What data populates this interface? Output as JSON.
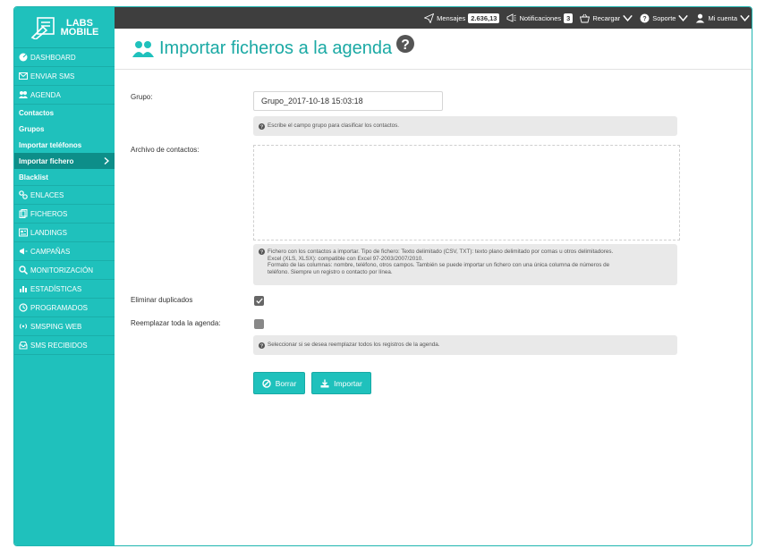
{
  "brand": {
    "line1": "LABS",
    "line2": "MOBILE"
  },
  "sidebar": {
    "items": [
      {
        "id": "dashboard",
        "label": "DASHBOARD"
      },
      {
        "id": "enviar-sms",
        "label": "ENVIAR SMS"
      },
      {
        "id": "agenda",
        "label": "AGENDA"
      }
    ],
    "agenda_sub": [
      {
        "id": "contactos",
        "label": "Contactos"
      },
      {
        "id": "grupos",
        "label": "Grupos"
      },
      {
        "id": "importar-telefonos",
        "label": "Importar teléfonos"
      },
      {
        "id": "importar-fichero",
        "label": "Importar fichero",
        "active": true
      },
      {
        "id": "blacklist",
        "label": "Blacklist"
      }
    ],
    "items2": [
      {
        "id": "enlaces",
        "label": "ENLACES"
      },
      {
        "id": "ficheros",
        "label": "FICHEROS"
      },
      {
        "id": "landings",
        "label": "LANDINGS"
      },
      {
        "id": "campanas",
        "label": "CAMPAÑAS"
      },
      {
        "id": "monitorizacion",
        "label": "MONITORIZACIÓN"
      },
      {
        "id": "estadisticas",
        "label": "ESTADÍSTICAS"
      },
      {
        "id": "programados",
        "label": "PROGRAMADOS"
      },
      {
        "id": "smsping-web",
        "label": "SMSPING WEB"
      },
      {
        "id": "sms-recibidos",
        "label": "SMS RECIBIDOS"
      }
    ]
  },
  "topbar": {
    "mensajes_label": "Mensajes",
    "mensajes_count": "2.636,13",
    "notificaciones_label": "Notificaciones",
    "notificaciones_count": "3",
    "recargar_label": "Recargar",
    "soporte_label": "Soporte",
    "cuenta_label": "Mi cuenta"
  },
  "page": {
    "title": "Importar ficheros a la agenda",
    "grupo_label": "Grupo:",
    "grupo_value": "Grupo_2017-10-18 15:03:18",
    "grupo_help": "Escribe el campo grupo para clasificar los contactos.",
    "archivo_label": "Archivo de contactos:",
    "archivo_help_1": "Fichero con los contactos a importar. Tipo de fichero: Texto delimitado (CSV, TXT): texto plano delimitado por comas u otros delimitadores.",
    "archivo_help_2": "Excel (XLS, XLSX): compatible con Excel 97-2003/2007/2010.",
    "archivo_help_3": "Formato de las columnas: nombre, teléfono, otros campos. También se puede importar un fichero con una única columna de números de",
    "archivo_help_4": "teléfono. Siempre un registro o contacto por línea.",
    "eliminar_label": "Eliminar duplicados",
    "reemplazar_label": "Reemplazar toda la agenda:",
    "reemplazar_help": "Seleccionar si se desea reemplazar todos los registros de la agenda.",
    "borrar_label": "Borrar",
    "importar_label": "Importar"
  },
  "colors": {
    "accent": "#1fc1bc",
    "topbar": "#3e3e3e",
    "active_sub": "#0d8e89"
  }
}
